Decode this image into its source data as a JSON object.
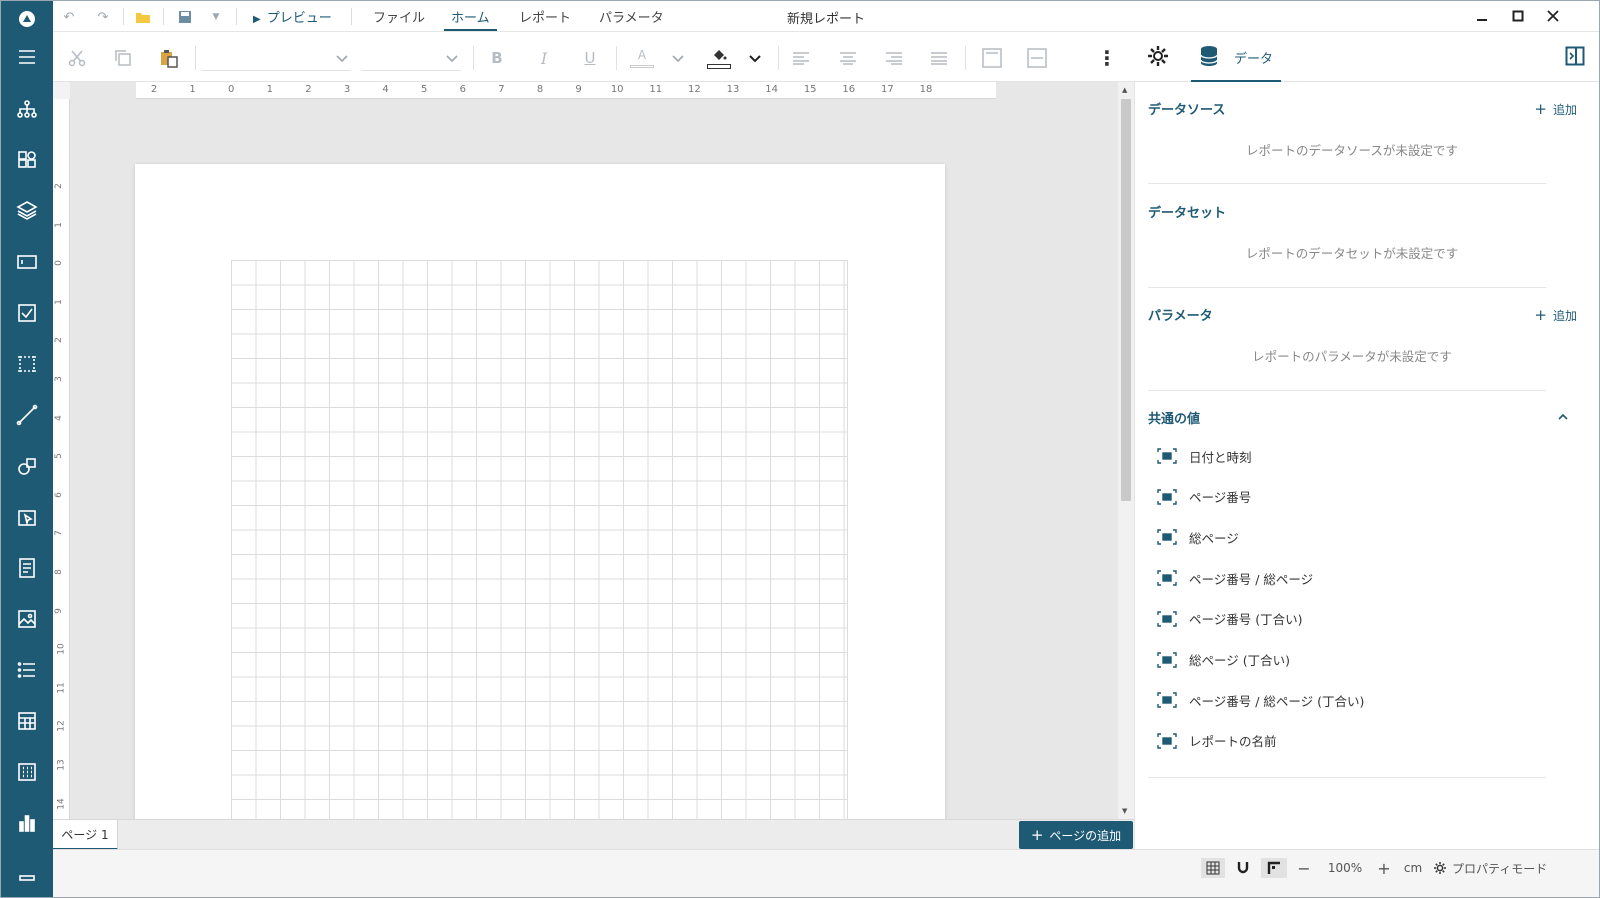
{
  "window": {
    "title": "新規レポート"
  },
  "titlebar": {
    "preview_label": "プレビュー",
    "tabs": [
      {
        "label": "ファイル",
        "active": false
      },
      {
        "label": "ホーム",
        "active": true
      },
      {
        "label": "レポート",
        "active": false
      },
      {
        "label": "パラメータ",
        "active": false
      }
    ]
  },
  "panel_tabs": {
    "data_label": "データ"
  },
  "ruler": {
    "top_labels": [
      "2",
      "1",
      "0",
      "1",
      "2",
      "3",
      "4",
      "5",
      "6",
      "7",
      "8",
      "9",
      "10",
      "11",
      "12",
      "13",
      "14",
      "15",
      "16",
      "17",
      "18"
    ],
    "left_labels": [
      "2",
      "1",
      "0",
      "1",
      "2",
      "3",
      "4",
      "5",
      "6",
      "7",
      "8",
      "9",
      "10",
      "11",
      "12",
      "13",
      "14"
    ]
  },
  "pages": {
    "tabs": [
      "ページ 1"
    ],
    "add_label": "ページの追加"
  },
  "statusbar": {
    "zoom": "100%",
    "unit": "cm",
    "property_mode": "プロパティモード"
  },
  "panel": {
    "datasource": {
      "title": "データソース",
      "add_label": "追加",
      "empty": "レポートのデータソースが未設定です"
    },
    "dataset": {
      "title": "データセット",
      "empty": "レポートのデータセットが未設定です"
    },
    "parameters": {
      "title": "パラメータ",
      "add_label": "追加",
      "empty": "レポートのパラメータが未設定です"
    },
    "common_values": {
      "title": "共通の値",
      "items": [
        "日付と時刻",
        "ページ番号",
        "総ページ",
        "ページ番号 / 総ページ",
        "ページ番号 (丁合い)",
        "総ページ (丁合い)",
        "ページ番号 / 総ページ (丁合い)",
        "レポートの名前"
      ]
    }
  },
  "colors": {
    "accent": "#1e5a74",
    "rail": "#1e5a74"
  }
}
